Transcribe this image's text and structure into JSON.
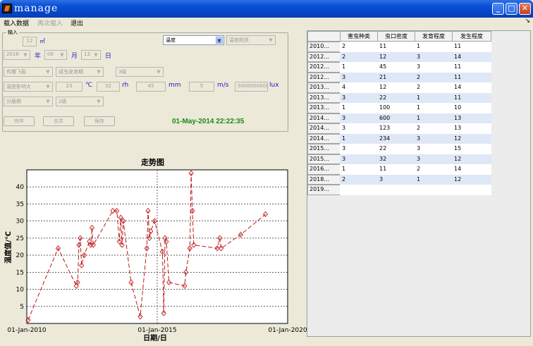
{
  "window": {
    "title": "manage"
  },
  "menu": {
    "items": [
      "载入数据",
      "再次载入",
      "退出"
    ],
    "more": "↘"
  },
  "panel": {
    "legend": "输入",
    "area_value": "12",
    "area_unit": "㎡",
    "metric_select": "温度",
    "correlation_select": "温度相关",
    "year_value": "2016",
    "year_label": "年",
    "month_value": "06",
    "month_label": "月",
    "day_value": "13",
    "day_label": "日",
    "pest_select": "传播飞虱",
    "stage_select": "成虫发育期",
    "level_select": "3级",
    "influence_select": "温度影响大",
    "temp_value": "23",
    "temp_unit": "℃",
    "humidity_value": "32",
    "humidity_unit": "rh",
    "rain_value": "45",
    "rain_unit": "mm",
    "wind_value": "5",
    "wind_unit": "m/s",
    "light_value": "5000000000",
    "light_unit": "lux",
    "period_select": "分蘖期",
    "grade_select": "2级",
    "buttons": [
      "完毕",
      "合并",
      "保存"
    ],
    "datetime": "01-May-2014 22:22:35"
  },
  "table": {
    "headers": [
      "害虫种类",
      "虫口密度",
      "发育程度",
      "发生程度"
    ],
    "rows": [
      {
        "label": "2010...",
        "cells": [
          "2",
          "11",
          "1",
          "11"
        ]
      },
      {
        "label": "2012...",
        "cells": [
          "2",
          "12",
          "3",
          "14"
        ]
      },
      {
        "label": "2012...",
        "cells": [
          "1",
          "45",
          "3",
          "11"
        ]
      },
      {
        "label": "2012...",
        "cells": [
          "3",
          "21",
          "2",
          "11"
        ]
      },
      {
        "label": "2013...",
        "cells": [
          "4",
          "12",
          "2",
          "14"
        ]
      },
      {
        "label": "2013...",
        "cells": [
          "3",
          "22",
          "1",
          "11"
        ]
      },
      {
        "label": "2013...",
        "cells": [
          "1",
          "100",
          "1",
          "10"
        ]
      },
      {
        "label": "2014...",
        "cells": [
          "3",
          "600",
          "1",
          "13"
        ]
      },
      {
        "label": "2014...",
        "cells": [
          "3",
          "123",
          "2",
          "13"
        ]
      },
      {
        "label": "2014...",
        "cells": [
          "1",
          "234",
          "3",
          "12"
        ]
      },
      {
        "label": "2015...",
        "cells": [
          "3",
          "22",
          "3",
          "15"
        ]
      },
      {
        "label": "2015...",
        "cells": [
          "3",
          "32",
          "3",
          "12"
        ]
      },
      {
        "label": "2016...",
        "cells": [
          "1",
          "11",
          "2",
          "14"
        ]
      },
      {
        "label": "2018...",
        "cells": [
          "2",
          "3",
          "1",
          "12"
        ]
      },
      {
        "label": "2019...",
        "cells": [
          "",
          "",
          "",
          ""
        ]
      }
    ]
  },
  "chart_data": {
    "type": "line",
    "title": "走势图",
    "xlabel": "日期/日",
    "ylabel": "温度值/℃",
    "xlim": [
      2010.0,
      2020.0
    ],
    "ylim": [
      0,
      45
    ],
    "xticks": [
      2010,
      2015,
      2020
    ],
    "xtick_labels": [
      "01-Jan-2010",
      "01-Jan-2015",
      "01-Jan-2020"
    ],
    "yticks": [
      5,
      10,
      15,
      20,
      25,
      30,
      35,
      40
    ],
    "grid": true,
    "color": "#c01818",
    "series": [
      {
        "x": [
          2010.05,
          2011.2,
          2011.9,
          2011.95,
          2012.0,
          2012.05,
          2012.1,
          2012.2,
          2012.4,
          2012.45,
          2012.5,
          2012.55,
          2013.3,
          2013.45,
          2013.55,
          2013.6,
          2013.65,
          2013.7,
          2014.0,
          2014.35,
          2014.6,
          2014.65,
          2014.7,
          2014.75,
          2014.9,
          2015.2,
          2015.25,
          2015.3,
          2015.35,
          2015.45,
          2016.05,
          2016.1,
          2016.25,
          2016.3,
          2016.35,
          2016.4,
          2017.3,
          2017.4,
          2017.45,
          2018.2,
          2019.15
        ],
        "y": [
          1,
          22,
          11,
          12,
          23,
          25,
          17,
          20,
          24,
          23,
          28,
          23,
          33,
          33,
          24,
          31,
          23,
          30,
          12,
          2,
          22,
          33,
          25,
          27,
          30,
          21,
          3,
          25,
          24,
          12,
          11,
          15,
          22,
          44,
          33,
          23,
          22,
          25,
          22,
          26,
          32
        ]
      }
    ]
  }
}
